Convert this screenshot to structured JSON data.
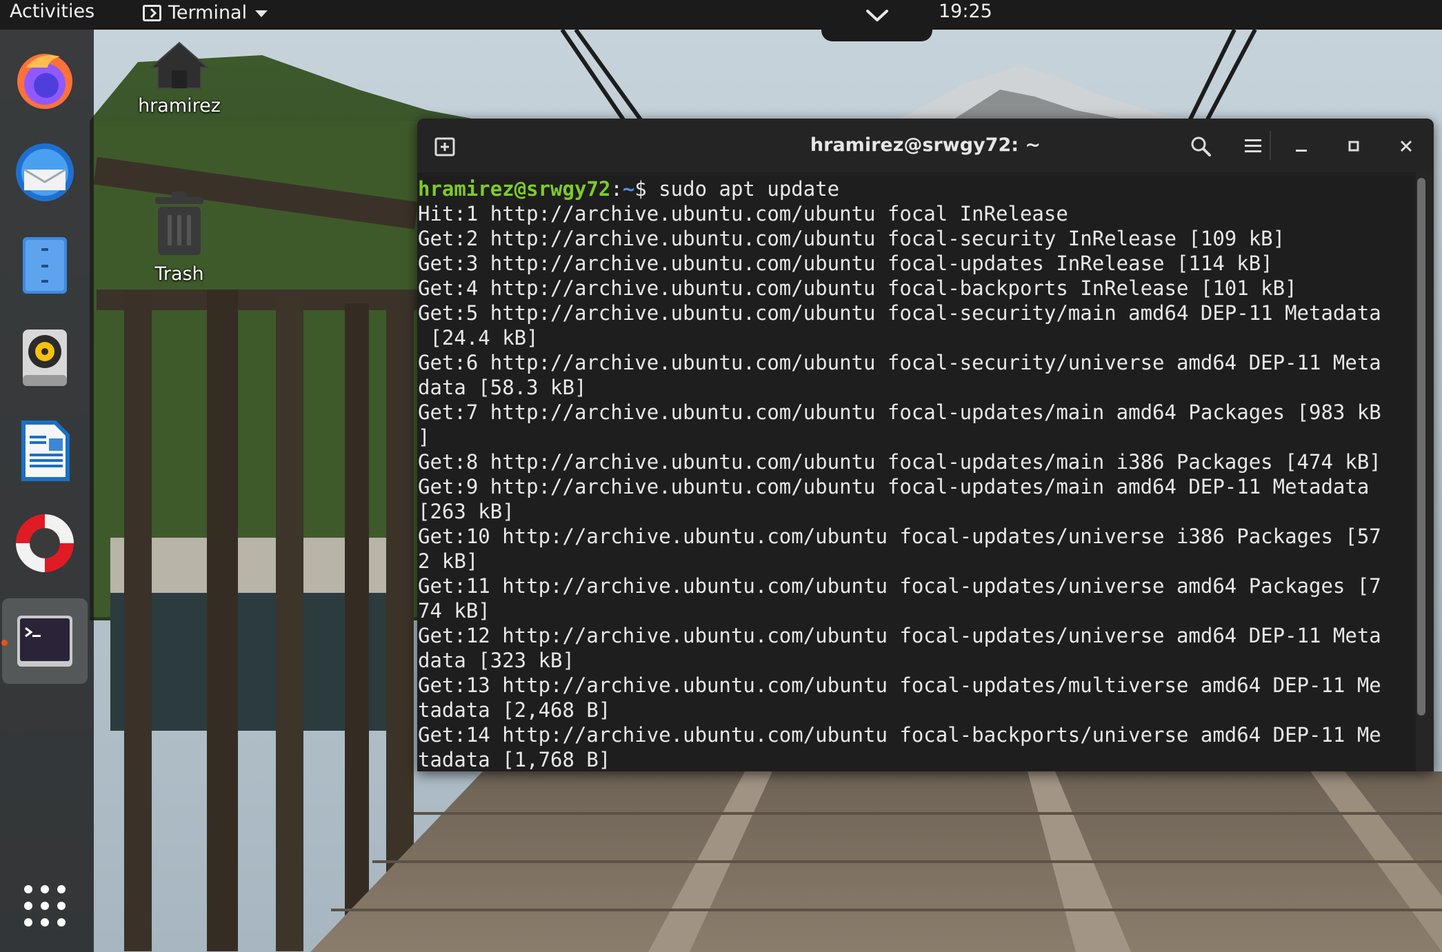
{
  "topbar": {
    "activities_label": "Activities",
    "app_menu_label": "Terminal",
    "clock": "19:25"
  },
  "desktop": {
    "home_label": "hramirez",
    "trash_label": "Trash"
  },
  "dock": {
    "items": [
      "firefox-icon",
      "thunderbird-icon",
      "files-icon",
      "rhythmbox-icon",
      "libreoffice-writer-icon",
      "help-icon",
      "terminal-icon"
    ],
    "apps_grid": "show-applications-icon"
  },
  "terminal": {
    "title": "hramirez@srwgy72: ~",
    "prompt_user": "hramirez@srwgy72",
    "prompt_sep": ":",
    "prompt_path": "~",
    "prompt_symbol": "$ ",
    "command": "sudo apt update",
    "output_lines": [
      "Hit:1 http://archive.ubuntu.com/ubuntu focal InRelease",
      "Get:2 http://archive.ubuntu.com/ubuntu focal-security InRelease [109 kB]",
      "Get:3 http://archive.ubuntu.com/ubuntu focal-updates InRelease [114 kB]",
      "Get:4 http://archive.ubuntu.com/ubuntu focal-backports InRelease [101 kB]",
      "Get:5 http://archive.ubuntu.com/ubuntu focal-security/main amd64 DEP-11 Metadata",
      " [24.4 kB]",
      "Get:6 http://archive.ubuntu.com/ubuntu focal-security/universe amd64 DEP-11 Meta",
      "data [58.3 kB]",
      "Get:7 http://archive.ubuntu.com/ubuntu focal-updates/main amd64 Packages [983 kB",
      "]",
      "Get:8 http://archive.ubuntu.com/ubuntu focal-updates/main i386 Packages [474 kB]",
      "Get:9 http://archive.ubuntu.com/ubuntu focal-updates/main amd64 DEP-11 Metadata",
      "[263 kB]",
      "Get:10 http://archive.ubuntu.com/ubuntu focal-updates/universe i386 Packages [57",
      "2 kB]",
      "Get:11 http://archive.ubuntu.com/ubuntu focal-updates/universe amd64 Packages [7",
      "74 kB]",
      "Get:12 http://archive.ubuntu.com/ubuntu focal-updates/universe amd64 DEP-11 Meta",
      "data [323 kB]",
      "Get:13 http://archive.ubuntu.com/ubuntu focal-updates/multiverse amd64 DEP-11 Me",
      "tadata [2,468 B]",
      "Get:14 http://archive.ubuntu.com/ubuntu focal-backports/universe amd64 DEP-11 Me",
      "tadata [1,768 B]"
    ]
  },
  "colors": {
    "prompt_user": "#7ecb28",
    "prompt_path": "#5a8fe0",
    "terminal_bg": "#1e1e1e",
    "accent": "#e95420"
  }
}
